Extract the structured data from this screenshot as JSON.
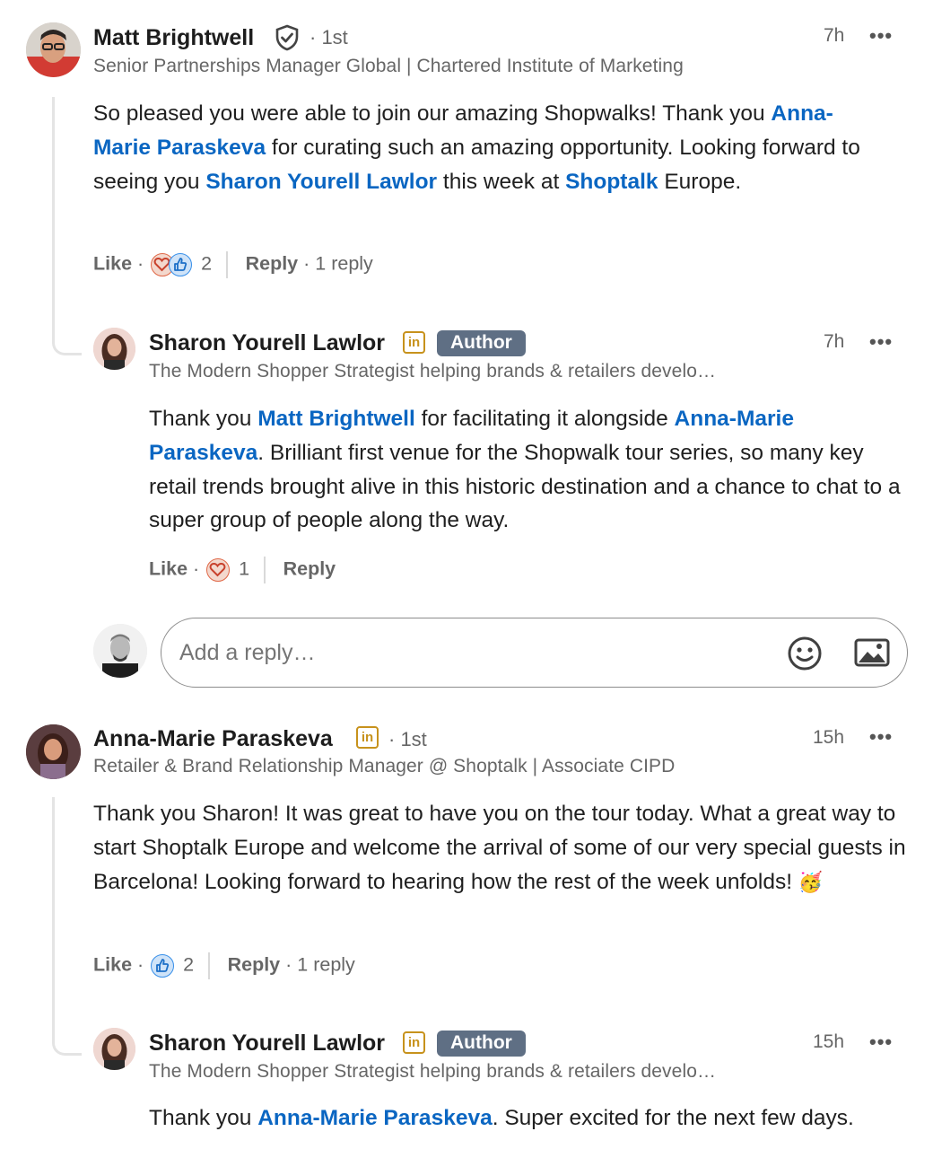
{
  "colors": {
    "mention": "#0a66c2",
    "author_badge": "#5f6f84",
    "in_badge": "#c7921c",
    "love": "#e06847",
    "like": "#378fe9"
  },
  "comments": [
    {
      "name": "Matt Brightwell",
      "degree": "· 1st",
      "headline": "Senior Partnerships Manager Global | Chartered Institute of Marketing",
      "time": "7h",
      "more": "•••",
      "text": {
        "p1": "So pleased you were able to join our amazing Shopwalks! Thank you ",
        "m1": "Anna-Marie Paraskeva",
        "p2": " for curating such an amazing opportunity. Looking forward to seeing you ",
        "m2": "Sharon Yourell Lawlor",
        "p3": " this week at ",
        "m3": "Shoptalk",
        "p4": " Europe."
      },
      "like": "Like",
      "dot": "·",
      "reaction_count": "2",
      "reply": "Reply",
      "replies": "· 1 reply"
    },
    {
      "name": "Sharon Yourell Lawlor",
      "in_badge": "in",
      "author": "Author",
      "headline": "The Modern Shopper Strategist helping brands & retailers develo…",
      "time": "7h",
      "more": "•••",
      "text": {
        "p1": "Thank you ",
        "m1": "Matt Brightwell",
        "p2": " for facilitating it alongside ",
        "m2": "Anna-Marie Paraskeva",
        "p3": ". Brilliant first venue for the Shopwalk tour series, so many key retail trends brought alive in this historic destination and a chance to chat to a super group of people along the way."
      },
      "like": "Like",
      "dot": "·",
      "reaction_count": "1",
      "reply": "Reply"
    },
    {
      "name": "Anna-Marie Paraskeva",
      "in_badge": "in",
      "degree": "· 1st",
      "headline": "Retailer & Brand Relationship Manager @ Shoptalk | Associate CIPD",
      "time": "15h",
      "more": "•••",
      "text": {
        "p1": "Thank you Sharon! It was great to have you on the tour today. What a great way to start Shoptalk Europe and welcome the arrival of some of our very special guests in Barcelona! Looking forward to hearing how the rest of the week unfolds! ",
        "emoji": "🥳"
      },
      "like": "Like",
      "dot": "·",
      "reaction_count": "2",
      "reply": "Reply",
      "replies": "· 1 reply"
    },
    {
      "name": "Sharon Yourell Lawlor",
      "in_badge": "in",
      "author": "Author",
      "headline": "The Modern Shopper Strategist helping brands & retailers develo…",
      "time": "15h",
      "more": "•••",
      "text": {
        "p1": "Thank you ",
        "m1": "Anna-Marie Paraskeva",
        "p2": ". Super excited for the next few days."
      }
    }
  ],
  "reply_input": {
    "placeholder": "Add a reply…",
    "emoji_icon": "emoji-icon",
    "image_icon": "image-icon"
  }
}
